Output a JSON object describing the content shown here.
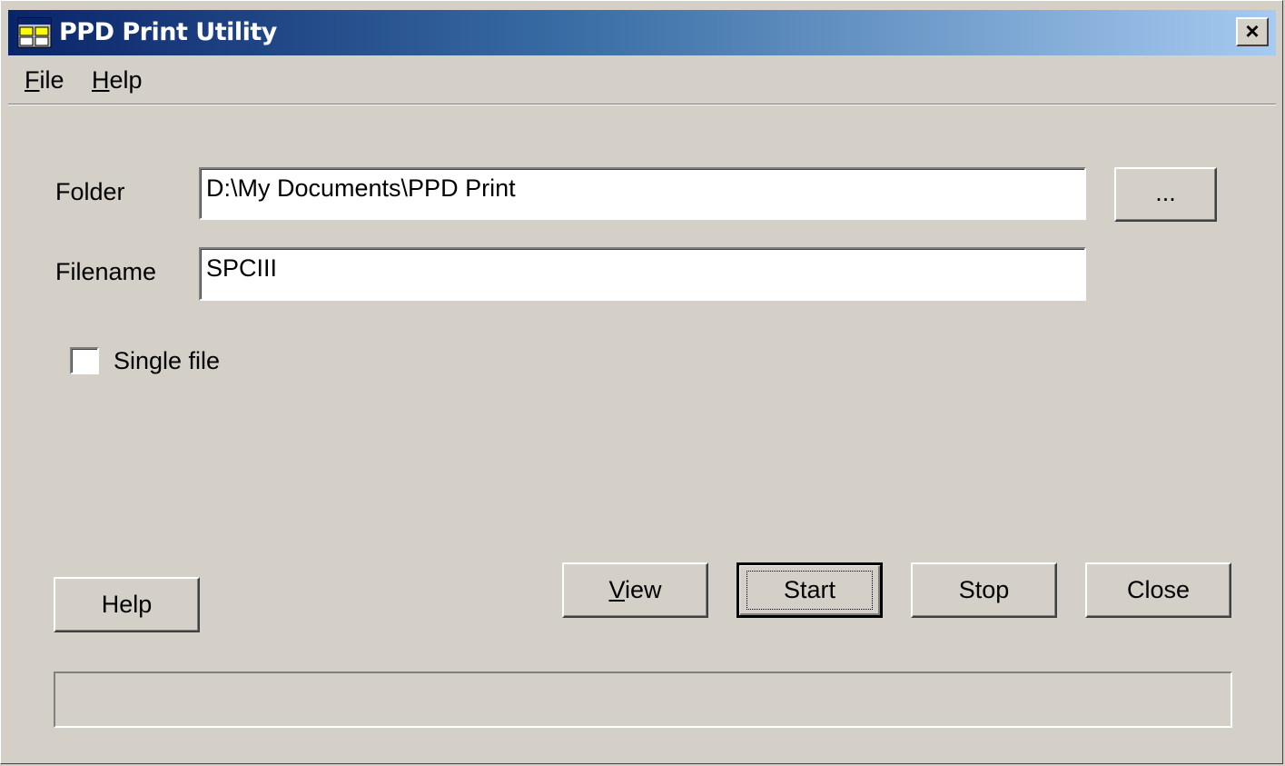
{
  "window": {
    "title": "PPD Print Utility",
    "close_glyph": "×"
  },
  "menu": {
    "file": {
      "accel": "F",
      "rest": "ile"
    },
    "help": {
      "accel": "H",
      "rest": "elp"
    }
  },
  "form": {
    "folder_label": "Folder",
    "folder_value": "D:\\My Documents\\PPD Print",
    "browse_label": "...",
    "filename_label": "Filename",
    "filename_value": "SPCIII",
    "single_file_label": "Single file",
    "single_file_checked": false
  },
  "buttons": {
    "help": "Help",
    "view": {
      "accel": "V",
      "rest": "iew"
    },
    "start": "Start",
    "stop": "Stop",
    "close": "Close"
  },
  "status": {
    "text": ""
  },
  "colors": {
    "titlebar_start": "#0a246a",
    "titlebar_end": "#a6caf0",
    "face": "#d4d0c8"
  },
  "icons": {
    "app": "app-window-icon",
    "close": "close-icon"
  }
}
